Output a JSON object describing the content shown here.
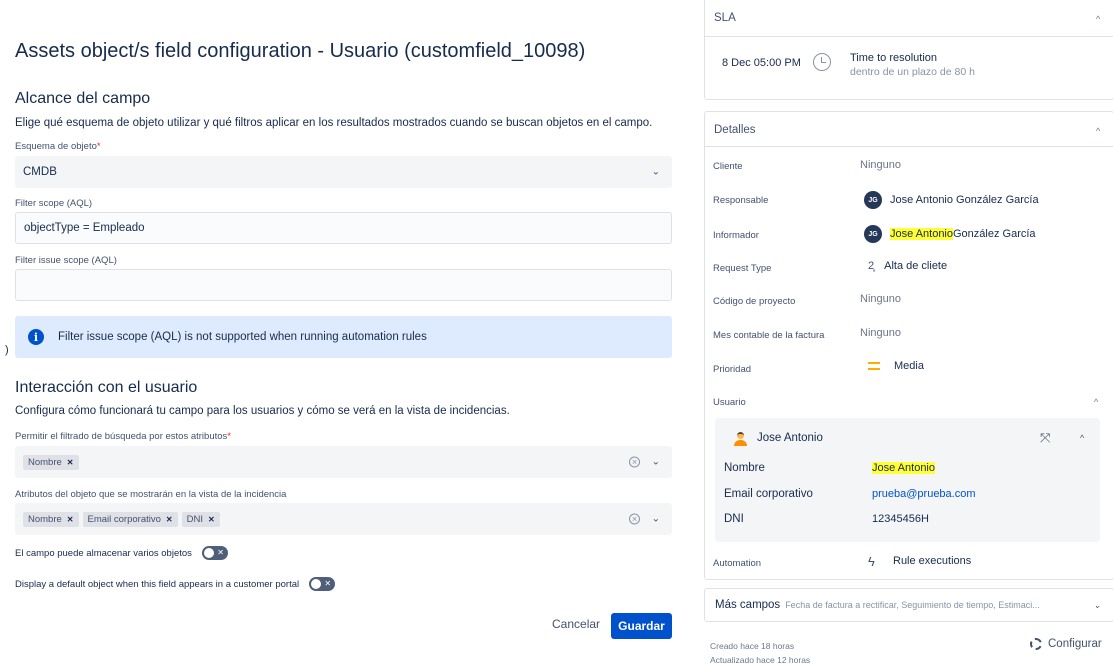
{
  "dialog": {
    "title": "Assets object/s field configuration - Usuario (customfield_10098)",
    "scope_section": {
      "heading": "Alcance del campo",
      "description": "Elige qué esquema de objeto utilizar y qué filtros aplicar en los resultados mostrados cuando se buscan objetos en el campo.",
      "schema_label": "Esquema de objeto",
      "schema_required": "*",
      "schema_value": "CMDB",
      "filter_scope_label": "Filter scope (AQL)",
      "filter_scope_value": "objectType = Empleado",
      "filter_issue_scope_label": "Filter issue scope (AQL)",
      "filter_issue_scope_value": "",
      "info_message": "Filter issue scope (AQL) is not supported when running automation rules"
    },
    "stray_char": ")",
    "interaction_section": {
      "heading": "Interacción con el usuario",
      "description": "Configura cómo funcionará tu campo para los usuarios y cómo se verá en la vista de incidencias.",
      "search_attrs_label": "Permitir el filtrado de búsqueda por estos atributos",
      "search_attrs_required": "*",
      "search_attrs": [
        "Nombre"
      ],
      "display_attrs_label": "Atributos del objeto que se mostrarán en la vista de la incidencia",
      "display_attrs": [
        "Nombre",
        "Email corporativo",
        "DNI"
      ],
      "multi_objects_label": "El campo puede almacenar varios objetos",
      "default_object_label": "Display a default object when this field appears in a customer portal",
      "toggle_x": "✕"
    },
    "buttons": {
      "cancel": "Cancelar",
      "save": "Guardar"
    }
  },
  "sidebar": {
    "sla": {
      "heading": "SLA",
      "time": "8 Dec 05:00 PM",
      "name": "Time to resolution",
      "sub": "dentro de un plazo de 80 h"
    },
    "details": {
      "heading": "Detalles",
      "cliente_label": "Cliente",
      "cliente_value": "Ninguno",
      "responsable_label": "Responsable",
      "responsable_initials": "JG",
      "responsable_value": "Jose Antonio González García",
      "informador_label": "Informador",
      "informador_initials": "JG",
      "informador_highlight": "Jose Antonio",
      "informador_rest": " González García",
      "request_type_label": "Request Type",
      "request_type_icon": "user-plus-icon",
      "request_type_value": "Alta de cliete",
      "codigo_label": "Código de proyecto",
      "codigo_value": "Ninguno",
      "mes_label": "Mes contable de la factura",
      "mes_value": "Ninguno",
      "prioridad_label": "Prioridad",
      "prioridad_value": "Media",
      "prioridad_color": "#ffab00",
      "usuario_label": "Usuario",
      "automation_label": "Automation",
      "automation_value": "Rule executions"
    },
    "object": {
      "name": "Jose Antonio",
      "attrs": [
        {
          "key": "Nombre",
          "value": "Jose Antonio"
        },
        {
          "key": "Email corporativo",
          "value": "prueba@prueba.com"
        },
        {
          "key": "DNI",
          "value": "12345456H"
        }
      ]
    },
    "more_fields": {
      "label": "Más campos",
      "summary": "Fecha de factura a rectificar, Seguimiento de tiempo, Estimaci..."
    },
    "footer": {
      "created": "Creado hace 18 horas",
      "updated": "Actualizado hace 12 horas",
      "configure": "Configurar"
    }
  },
  "colors": {
    "primary": "#0052cc",
    "highlight": "#ffff33",
    "info_bg": "#deebff"
  }
}
